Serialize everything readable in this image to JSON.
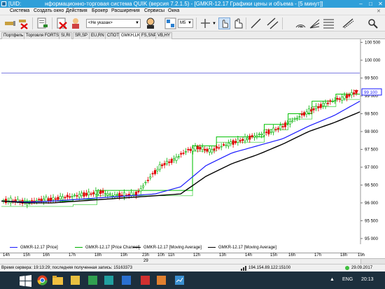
{
  "window": {
    "title_left": "[UID:",
    "title_right": "нформационно-торговая система QUIK (версия 7.2.1.5) - [GMKR-12.17 Графики цены и объема - [5 минут]]",
    "btn_min": "–",
    "btn_max": "□",
    "btn_close": "✕"
  },
  "menu": [
    "Система",
    "Создать окно",
    "Действия",
    "Брокер",
    "Расширения",
    "Сервисы",
    "Окна"
  ],
  "toolbar": {
    "account_combo": "<Не указан>",
    "interval_combo": "M5",
    "icons": [
      "connect-icon",
      "disconnect-icon",
      "new-order-icon",
      "kill-order-icon",
      "client-icon",
      "chart-type-icon",
      "crosshair-icon",
      "hand-icon",
      "line-icon",
      "parallel-lines-icon",
      "arc-icon",
      "fan-icon",
      "fibo-icon",
      "channel-icon",
      "magnify-icon"
    ]
  },
  "tabs": [
    "Портфель",
    "Торговля FORTS",
    "SI,RI",
    "SR,SP",
    "EU,RN",
    "СПОТ",
    "GMKH,LK",
    "FS,SNP",
    "VB,HY"
  ],
  "active_tab": "GMKH,LK",
  "chart_data": {
    "type": "line",
    "y_ticks": [
      "100 500",
      "100 000",
      "99 500",
      "99 000",
      "98 500",
      "98 000",
      "97 500",
      "97 000",
      "96 500",
      "96 000",
      "95 500",
      "95 000"
    ],
    "ylim": [
      94900,
      100550
    ],
    "x_ticks": [
      "14h",
      "15h",
      "16h",
      "17h",
      "18h",
      "19h",
      "23h",
      "10h",
      "11h",
      "12h",
      "13h",
      "14h",
      "15h",
      "16h",
      "17h",
      "18h",
      "19h"
    ],
    "day_label": "29",
    "last_price_label": "99 100",
    "horizontal_level": 99640,
    "series": [
      {
        "name": "GMKR-12.17 [Price]",
        "color": "#00b000"
      },
      {
        "name": "GMKR-12.17 [Price Channel]",
        "color": "#00c000",
        "values": [
          96050,
          96050,
          96050,
          96100,
          96350,
          96350,
          96350,
          96350,
          97600,
          97850,
          97850,
          98200,
          98500,
          98850,
          99050
        ]
      },
      {
        "name": "GMKR-12.17 [Moving Average]",
        "color": "#1a1aff",
        "values": [
          96050,
          96020,
          96050,
          96100,
          96150,
          96200,
          96250,
          96450,
          97050,
          97400,
          97600,
          97800,
          98150,
          98450,
          98850
        ]
      },
      {
        "name": "GMKR-12.17 [Moving Average]",
        "color": "#000000",
        "values": [
          96050,
          96000,
          96000,
          96050,
          96100,
          96150,
          96200,
          96250,
          96750,
          97100,
          97350,
          97650,
          98000,
          98250,
          98550
        ]
      }
    ],
    "close_path": [
      96050,
      96060,
      96000,
      96080,
      96100,
      96150,
      96200,
      96250,
      96300,
      96200,
      96220,
      96250,
      96700,
      97050,
      97200,
      97450,
      97550,
      97450,
      97600,
      97700,
      97800,
      97900,
      98000,
      98150,
      98350,
      98550,
      98700,
      98850,
      98950,
      99100
    ]
  },
  "legend": [
    {
      "label": "GMKR-12.17 [Price]",
      "color": "#1a1aff"
    },
    {
      "label": "GMKR-12.17 [Price Channel]",
      "color": "#00b000"
    },
    {
      "label": "GMKR-12.17 [Moving Average]",
      "color": "#000000"
    },
    {
      "label": "GMKR-12.17 [Moving Average]",
      "color": "#000000"
    }
  ],
  "status": {
    "server_time": "Время сервера: 19:13:29; последняя полученная запись: 15163373",
    "ip": "194.154.89.122:15100",
    "date": "29.09.2017"
  },
  "taskbar": {
    "lang": "ENG",
    "clock": "20:13"
  }
}
